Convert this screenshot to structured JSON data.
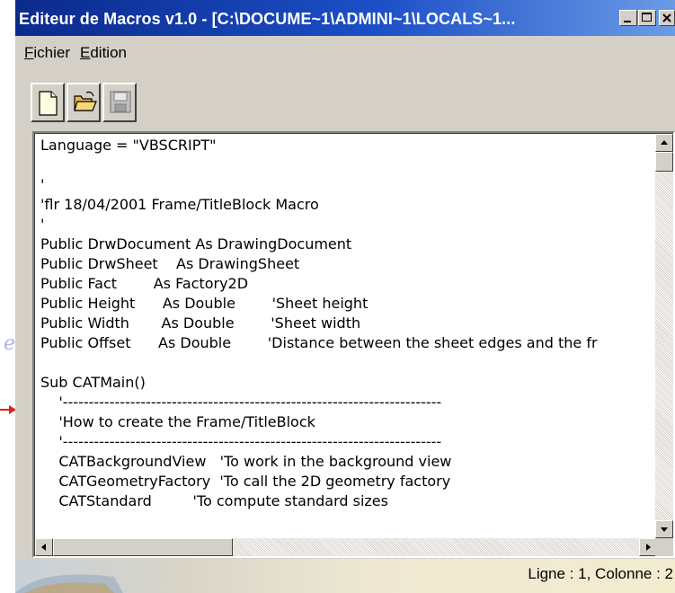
{
  "window": {
    "title": "Editeur de Macros v1.0 - [C:\\DOCUME~1\\ADMINI~1\\LOCALS~1..."
  },
  "menu": {
    "items": [
      {
        "accel": "F",
        "rest": "ichier"
      },
      {
        "accel": "E",
        "rest": "dition"
      }
    ]
  },
  "toolbar": {
    "icons": [
      "new-document-icon",
      "open-folder-icon",
      "save-disk-icon"
    ]
  },
  "editor": {
    "lines": [
      "Language = \"VBSCRIPT\"",
      "",
      "'",
      "'flr 18/04/2001 Frame/TitleBlock Macro",
      "'",
      "Public DrwDocument As DrawingDocument",
      "Public DrwSheet    As DrawingSheet",
      "Public Fact        As Factory2D",
      "Public Height      As Double        'Sheet height",
      "Public Width       As Double        'Sheet width",
      "Public Offset      As Double        'Distance between the sheet edges and the fr",
      "",
      "Sub CATMain()",
      "    '-------------------------------------------------------------------------",
      "    'How to create the Frame/TitleBlock",
      "    '-------------------------------------------------------------------------",
      "    CATBackgroundView   'To work in the background view",
      "    CATGeometryFactory  'To call the 2D geometry factory",
      "    CATStandard         'To compute standard sizes"
    ]
  },
  "status": {
    "text": "Ligne : 1, Colonne : 2"
  },
  "colors": {
    "titlebar_start": "#0b2a8c",
    "titlebar_end": "#6b9be6",
    "chrome": "#d4d0c8"
  }
}
